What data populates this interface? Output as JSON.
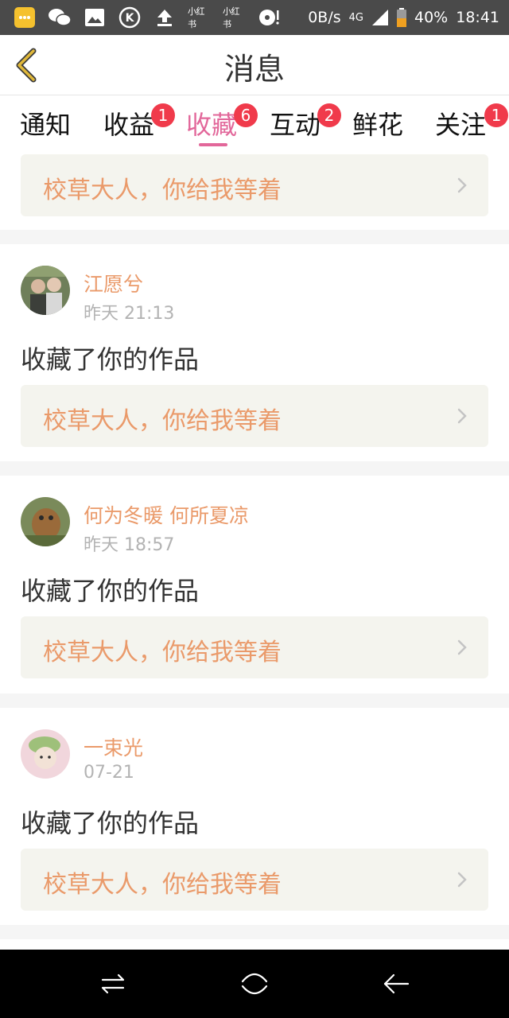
{
  "status_bar": {
    "network_speed": "0B/s",
    "network_type": "4G",
    "battery": "40%",
    "time": "18:41",
    "app_icons": [
      "chat-app-icon",
      "wechat-icon",
      "gallery-icon",
      "k-app-icon",
      "upload-icon",
      "xiaohongshu-icon",
      "xiaohongshu-icon",
      "music-icon"
    ],
    "xiaohongshu_label": "小红书"
  },
  "header": {
    "title": "消息"
  },
  "tabs": [
    {
      "label": "通知",
      "badge": ""
    },
    {
      "label": "收益",
      "badge": "1"
    },
    {
      "label": "收藏",
      "badge": "6"
    },
    {
      "label": "互动",
      "badge": "2"
    },
    {
      "label": "鲜花",
      "badge": ""
    },
    {
      "label": "关注",
      "badge": "1"
    }
  ],
  "feed": {
    "partial_top": {
      "work_title": "校草大人，你给我等着"
    },
    "items": [
      {
        "name": "江愿兮",
        "time": "昨天 21:13",
        "message": "收藏了你的作品",
        "work_title": "校草大人，你给我等着"
      },
      {
        "name": "何为冬暖 何所夏凉",
        "time": "昨天 18:57",
        "message": "收藏了你的作品",
        "work_title": "校草大人，你给我等着"
      },
      {
        "name": "一束光",
        "time": "07-21",
        "message": "收藏了你的作品",
        "work_title": "校草大人，你给我等着"
      }
    ]
  },
  "colors": {
    "accent": "#e2679a",
    "badge": "#f03a4b",
    "name": "#ea9a6a",
    "back_arrow": "#e0b83a"
  }
}
